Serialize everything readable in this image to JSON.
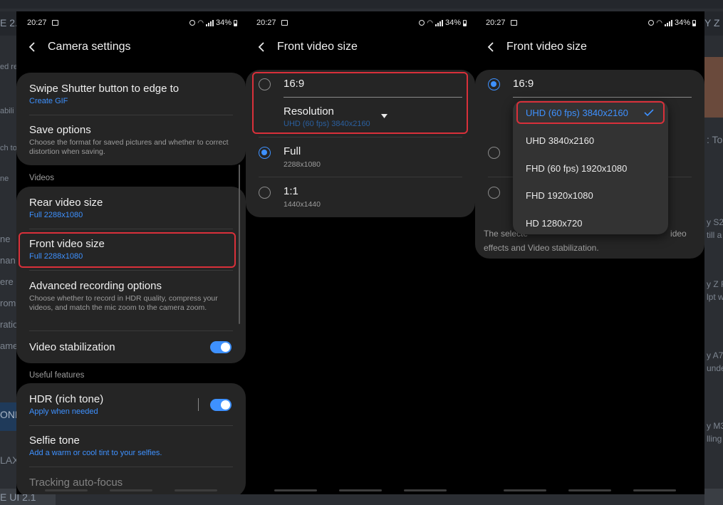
{
  "status": {
    "time": "20:27",
    "battery": "34%"
  },
  "screen1": {
    "title": "Camera settings",
    "items": [
      {
        "title": "Swipe Shutter button to edge to",
        "sub": "Create GIF"
      },
      {
        "title": "Save options",
        "desc": "Choose the format for saved pictures and whether to correct distortion when saving."
      },
      {
        "title": "Rear video size",
        "sub": "Full 2288x1080"
      },
      {
        "title": "Front video size",
        "sub": "Full 2288x1080"
      },
      {
        "title": "Advanced recording options",
        "desc": "Choose whether to record in HDR quality, compress your videos, and match the mic zoom to the camera zoom."
      },
      {
        "title": "Video stabilization"
      },
      {
        "title": "HDR (rich tone)",
        "sub": "Apply when needed"
      },
      {
        "title": "Selfie tone",
        "sub": "Add a warm or cool tint to your selfies."
      },
      {
        "title": "Tracking auto-focus"
      }
    ],
    "section_videos": "Videos",
    "section_useful": "Useful features",
    "toggles": {
      "video_stabilization": true,
      "hdr": true
    }
  },
  "screen2": {
    "title": "Front video size",
    "option_169": "16:9",
    "resolution_label": "Resolution",
    "resolution_value": "UHD (60 fps) 3840x2160",
    "option_full": "Full",
    "option_full_sub": "2288x1080",
    "option_11": "1:1",
    "option_11_sub": "1440x1440",
    "selected": "Full"
  },
  "screen3": {
    "title": "Front video size",
    "option_169": "16:9",
    "dropdown_options": [
      "UHD (60 fps) 3840x2160",
      "UHD 3840x2160",
      "FHD (60 fps) 1920x1080",
      "FHD 1920x1080",
      "HD 1280x720"
    ],
    "selected_option": "UHD (60 fps) 3840x2160",
    "note_visible_start": "The selecte",
    "note_visible_end": "ideo",
    "note_line2": "effects and Video stabilization."
  },
  "background": {
    "texts": [
      "E 2.1",
      "Y Z",
      ": Tod",
      "y S2",
      "till a",
      "y Z F",
      "lpt w",
      "y A7",
      "unde",
      "y M3",
      "lling",
      "ONE",
      "LAXY",
      "E UI 2.1",
      "ne",
      "nan",
      "ere",
      "rom",
      "ratio",
      "ame",
      "ed re",
      "abili",
      "ch to",
      "ne"
    ]
  },
  "colors": {
    "accent": "#3e91ff",
    "highlight": "#d9303a",
    "card": "#252525"
  }
}
